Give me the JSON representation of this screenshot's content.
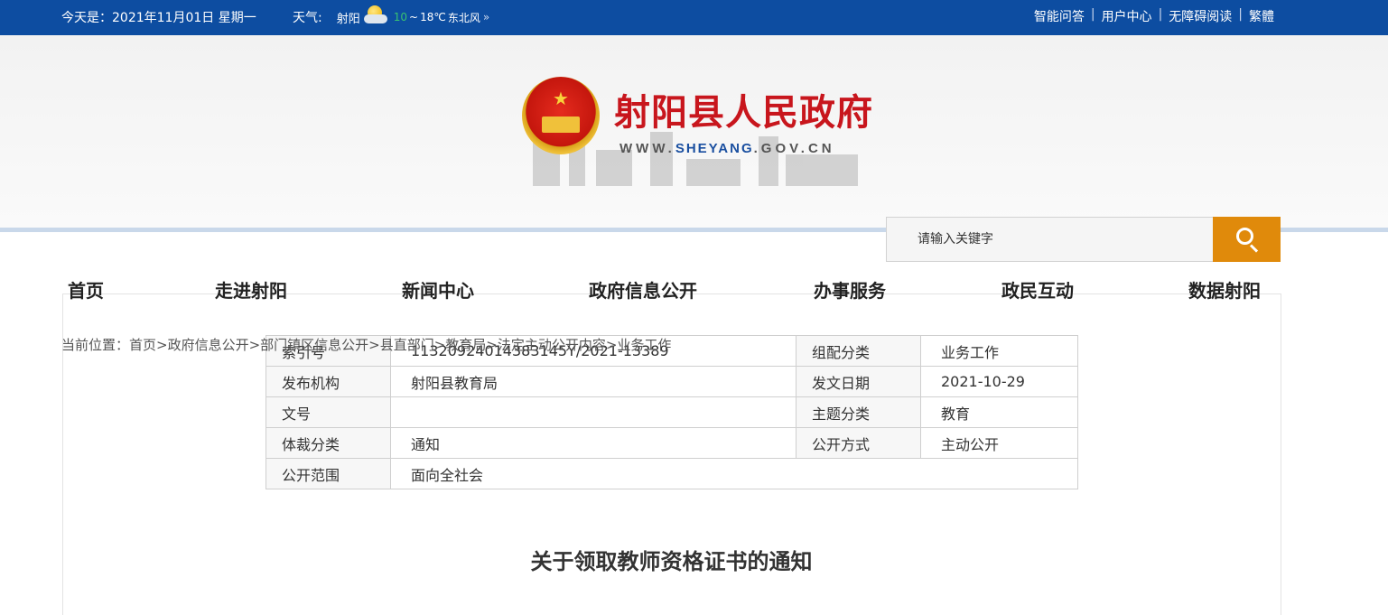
{
  "topbar": {
    "date": "今天是：2021年11月01日 星期一",
    "weather_label": "天气:",
    "city": "射阳",
    "temp_low": "10",
    "temp_sep": "~",
    "temp_high": "18℃",
    "wind": "东北风",
    "more": "»",
    "links": [
      "智能问答",
      "用户中心",
      "无障碍阅读",
      "繁體"
    ],
    "separator": "|"
  },
  "header": {
    "title": "射阳县人民政府",
    "url_prefix": "WWW.",
    "url_main": "SHEYANG",
    "url_suffix": ".GOV.CN",
    "bg_color": "#0d4da1",
    "title_color": "#c8161d"
  },
  "search": {
    "placeholder": "请输入关键字",
    "button_color": "#e08a0b"
  },
  "nav": {
    "items": [
      "首页",
      "走进射阳",
      "新闻中心",
      "政府信息公开",
      "办事服务",
      "政民互动",
      "数据射阳"
    ]
  },
  "breadcrumb": "当前位置：首页>政府信息公开>部门镇区信息公开>县直部门>教育局>法定主动公开内容>业务工作",
  "meta": {
    "rows": [
      {
        "k1": "索引号",
        "v1": "11320924014383145Y/2021-13389",
        "k2": "组配分类",
        "v2": "业务工作"
      },
      {
        "k1": "发布机构",
        "v1": "射阳县教育局",
        "k2": "发文日期",
        "v2": "2021-10-29"
      },
      {
        "k1": "文号",
        "v1": "",
        "k2": "主题分类",
        "v2": "教育"
      },
      {
        "k1": "体裁分类",
        "v1": "通知",
        "k2": "公开方式",
        "v2": "主动公开"
      },
      {
        "k1": "公开范围",
        "v1": "面向全社会"
      }
    ]
  },
  "article": {
    "title": "关于领取教师资格证书的通知"
  }
}
